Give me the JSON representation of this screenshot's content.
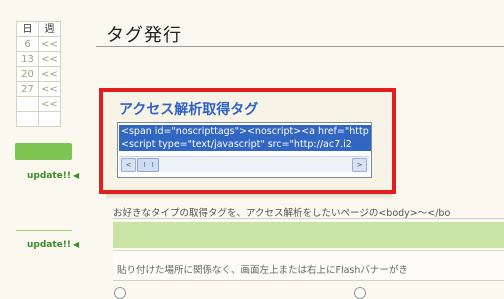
{
  "calendar": {
    "head": [
      "日",
      "週"
    ],
    "rows": [
      [
        "6",
        "<<"
      ],
      [
        "13",
        "<<"
      ],
      [
        "20",
        "<<"
      ],
      [
        "27",
        "<<"
      ],
      [
        "",
        "<<"
      ],
      [
        "",
        ""
      ]
    ]
  },
  "sidebar": {
    "update_label_1": "update!!",
    "update_label_2": "update!!"
  },
  "page": {
    "title": "タグ発行"
  },
  "tag_box": {
    "title": "アクセス解析取得タグ",
    "line1": "<span id=\"noscripttags\"><noscript><a href=\"http",
    "line2": "<script type=\"text/javascript\" src=\"http://ac7.i2",
    "scroll_left": "<",
    "scroll_right": ">"
  },
  "content": {
    "description": "お好きなタイプの取得タグを、アクセス解析をしたいページの<body>〜</bo",
    "note": "貼り付けた場所に関係なく、画面左上または右上にFlashバナーがき"
  }
}
